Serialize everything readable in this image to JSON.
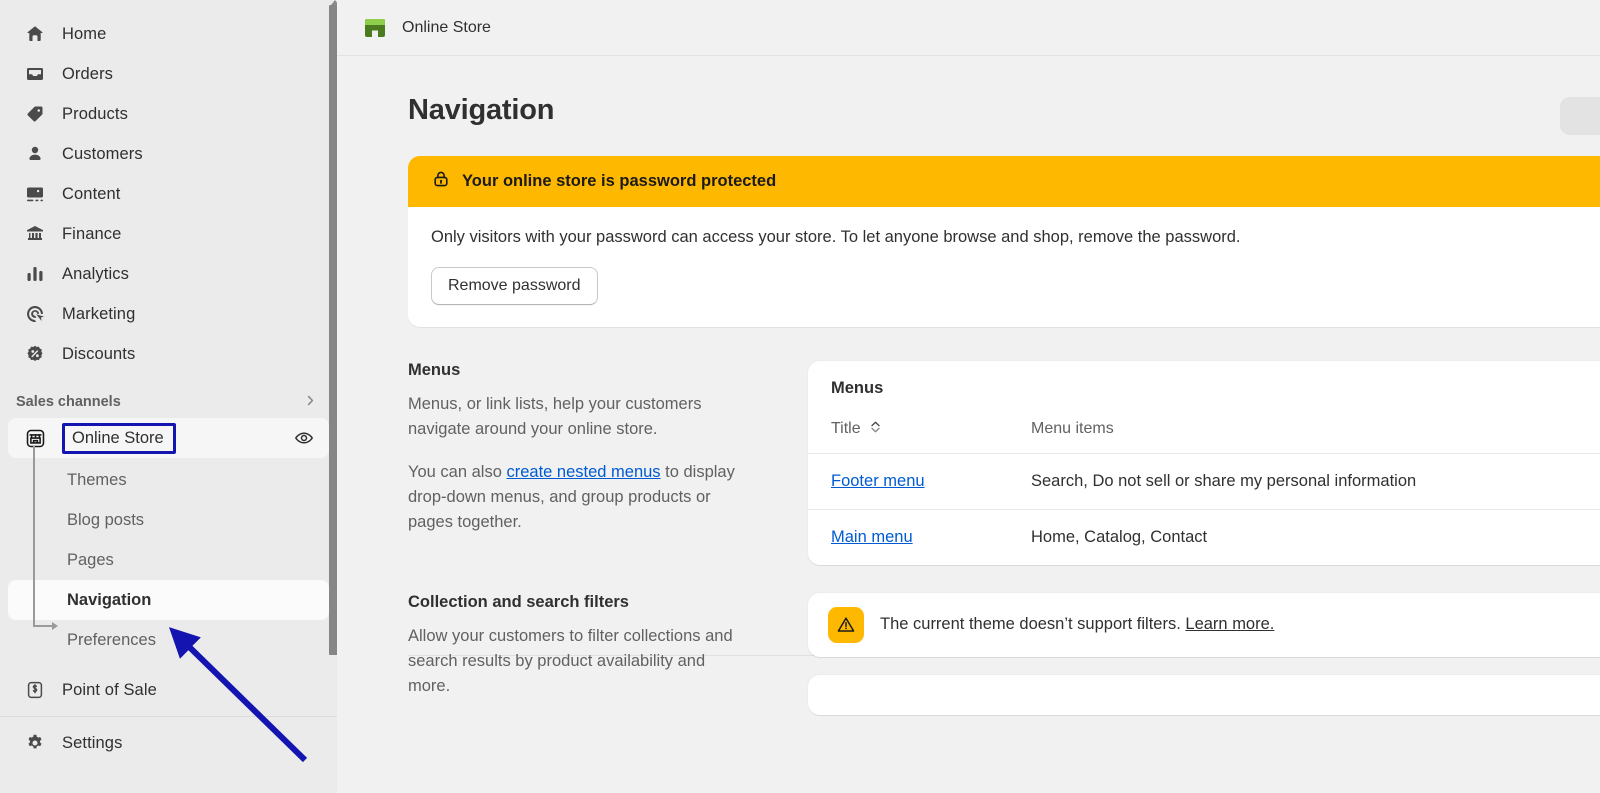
{
  "sidebar": {
    "main_items": [
      {
        "label": "Home",
        "icon": "home-icon"
      },
      {
        "label": "Orders",
        "icon": "orders-inbox-icon"
      },
      {
        "label": "Products",
        "icon": "products-tag-icon"
      },
      {
        "label": "Customers",
        "icon": "customers-person-icon"
      },
      {
        "label": "Content",
        "icon": "content-image-icon"
      },
      {
        "label": "Finance",
        "icon": "finance-bank-icon"
      },
      {
        "label": "Analytics",
        "icon": "analytics-bars-icon"
      },
      {
        "label": "Marketing",
        "icon": "marketing-target-icon"
      },
      {
        "label": "Discounts",
        "icon": "discounts-percent-icon"
      }
    ],
    "section": {
      "label": "Sales channels",
      "chevron": "chevron-right-icon"
    },
    "store": {
      "label": "Online Store",
      "icon": "storefront-icon",
      "view_icon": "eye-icon"
    },
    "sub_items": [
      {
        "label": "Themes"
      },
      {
        "label": "Blog posts"
      },
      {
        "label": "Pages"
      },
      {
        "label": "Navigation"
      },
      {
        "label": "Preferences"
      }
    ],
    "selected_sub": "Navigation",
    "bottom_items": [
      {
        "label": "Point of Sale",
        "icon": "pos-shopify-bag-icon"
      },
      {
        "label": "Settings",
        "icon": "settings-gear-icon"
      }
    ],
    "highlight_color": "#1414b0"
  },
  "topbar": {
    "store_name": "Online Store",
    "store_icon": "shopify-storefront-green-icon"
  },
  "page": {
    "title": "Navigation"
  },
  "banner": {
    "icon": "lock-icon",
    "heading": "Your online store is password protected",
    "description": "Only visitors with your password can access your store. To let anyone browse and shop, remove the password.",
    "button_label": "Remove password",
    "accent_color": "#ffb800"
  },
  "menus_section": {
    "heading": "Menus",
    "paragraph1": "Menus, or link lists, help your customers navigate around your online store.",
    "paragraph2_before": "You can also ",
    "paragraph2_link": "create nested menus",
    "paragraph2_after": " to display drop-down menus, and group products or pages together."
  },
  "menus_card": {
    "title": "Menus",
    "columns": [
      "Title",
      "Menu items"
    ],
    "sort_icon": "sort-updown-icon",
    "rows": [
      {
        "title": "Footer menu",
        "items": "Search, Do not sell or share my personal information"
      },
      {
        "title": "Main menu",
        "items": "Home, Catalog, Contact"
      }
    ],
    "link_color": "#005bd3"
  },
  "filters_section": {
    "heading": "Collection and search filters",
    "paragraph": "Allow your customers to filter collections and search results by product availability and more."
  },
  "filters_card": {
    "icon": "warning-triangle-icon",
    "text_before": "The current theme doesn’t support filters. ",
    "link": "Learn more.",
    "accent_color": "#ffb800"
  },
  "annotation": {
    "arrow_color": "#1414b0",
    "target": "Navigation"
  }
}
